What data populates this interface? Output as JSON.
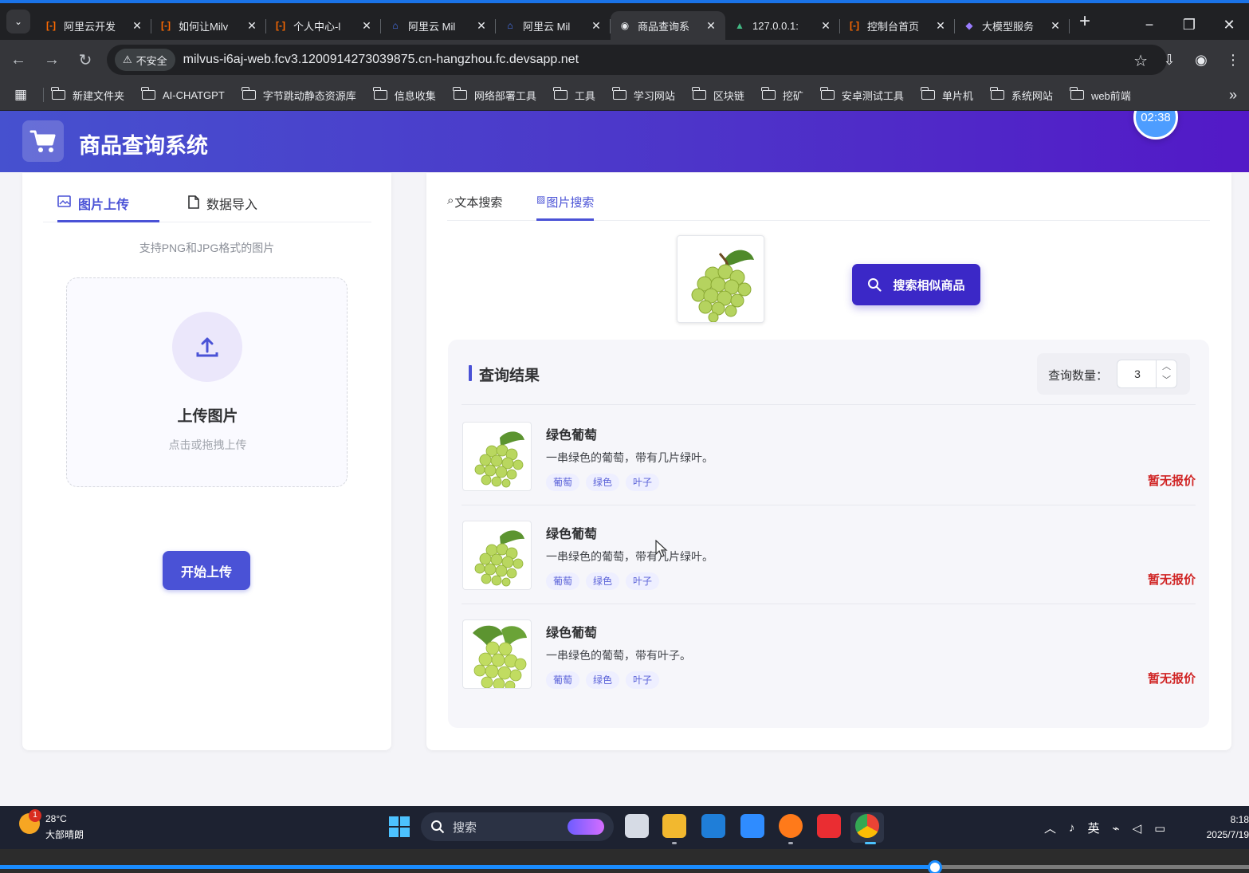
{
  "browser": {
    "tabs": [
      {
        "title": "阿里云开发",
        "icon": "aliyun-icon",
        "active": false
      },
      {
        "title": "如何让Milv",
        "icon": "aliyun-icon",
        "active": false
      },
      {
        "title": "个人中心-l",
        "icon": "aliyun-icon",
        "active": false
      },
      {
        "title": "阿里云 Mil",
        "icon": "milvus-icon",
        "active": false
      },
      {
        "title": "阿里云 Mil",
        "icon": "milvus-icon",
        "active": false
      },
      {
        "title": "商品查询系",
        "icon": "globe-icon",
        "active": true
      },
      {
        "title": "127.0.0.1:",
        "icon": "vue-icon",
        "active": false
      },
      {
        "title": "控制台首页",
        "icon": "aliyun-icon",
        "active": false
      },
      {
        "title": "大模型服务",
        "icon": "model-icon",
        "active": false
      }
    ],
    "security_label": "不安全",
    "url": "milvus-i6aj-web.fcv3.1200914273039875.cn-hangzhou.fc.devsapp.net",
    "bookmarks": [
      "新建文件夹",
      "AI-CHATGPT",
      "字节跳动静态资源库",
      "信息收集",
      "网络部署工具",
      "工具",
      "学习网站",
      "区块链",
      "挖矿",
      "安卓测试工具",
      "单片机",
      "系统网站",
      "web前端"
    ],
    "more_bookmarks": "»"
  },
  "app": {
    "title": "商品查询系统",
    "timer": "02:38",
    "brand_color": "#4a52d6"
  },
  "left_panel": {
    "tabs": [
      "图片上传",
      "数据导入"
    ],
    "support_text": "支持PNG和JPG格式的图片",
    "upload_title": "上传图片",
    "upload_hint": "点击或拖拽上传",
    "start_button": "开始上传"
  },
  "right_panel": {
    "tabs": [
      "文本搜索",
      "图片搜索"
    ],
    "search_button": "搜索相似商品",
    "results_title": "查询结果",
    "quantity_label": "查询数量：",
    "quantity_value": "3",
    "results": [
      {
        "name": "绿色葡萄",
        "description": "一串绿色的葡萄，带有几片绿叶。",
        "tags": [
          "葡萄",
          "绿色",
          "叶子"
        ],
        "price": "暂无报价"
      },
      {
        "name": "绿色葡萄",
        "description": "一串绿色的葡萄，带有几片绿叶。",
        "tags": [
          "葡萄",
          "绿色",
          "叶子"
        ],
        "price": "暂无报价"
      },
      {
        "name": "绿色葡萄",
        "description": "一串绿色的葡萄，带有叶子。",
        "tags": [
          "葡萄",
          "绿色",
          "叶子"
        ],
        "price": "暂无报价"
      }
    ]
  },
  "taskbar": {
    "weather_badge": "1",
    "temperature": "28°C",
    "weather": "大部晴朗",
    "search_placeholder": "搜索",
    "ime": "英",
    "time": "8:18",
    "date": "2025/7/19"
  },
  "video": {
    "progress": 0.749
  }
}
